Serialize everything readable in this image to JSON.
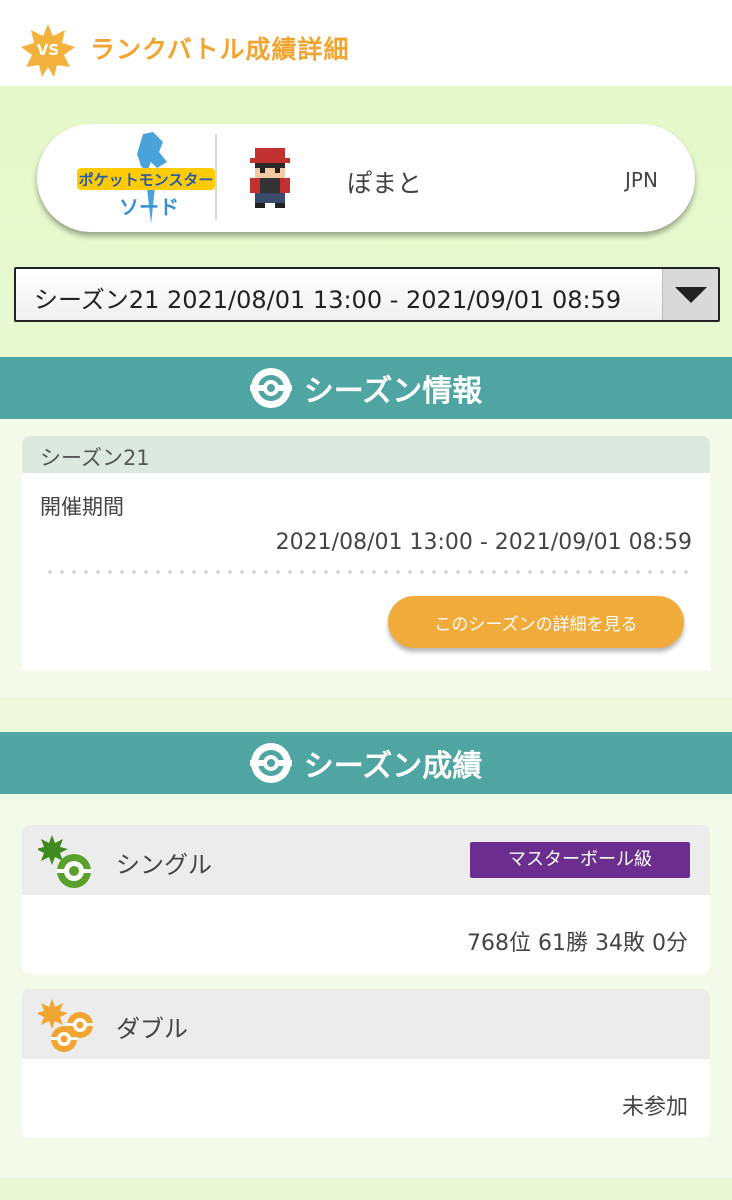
{
  "header": {
    "badge_text": "VS",
    "title": "ランクバトル成績詳細",
    "accent_color": "#f0a531"
  },
  "trainer": {
    "game_logo_text": "ポケットモンスター",
    "game_logo_sub": "ソード",
    "name": "ぽまと",
    "country": "JPN"
  },
  "season_select": {
    "selected": "シーズン21 2021/08/01 13:00 - 2021/09/01 08:59"
  },
  "season_info": {
    "section_title": "シーズン情報",
    "season_name": "シーズン21",
    "period_label": "開催期間",
    "period_value": "2021/08/01 13:00 - 2021/09/01 08:59",
    "detail_button": "このシーズンの詳細を見る"
  },
  "season_results": {
    "section_title": "シーズン成績",
    "single": {
      "title": "シングル",
      "rank_badge": "マスターボール級",
      "value": "768位 61勝 34敗 0分"
    },
    "double": {
      "title": "ダブル",
      "value": "未参加"
    }
  },
  "colors": {
    "section_header": "#4ea5a2",
    "button": "#f1ab3b",
    "master_badge": "#6b2e8f"
  }
}
